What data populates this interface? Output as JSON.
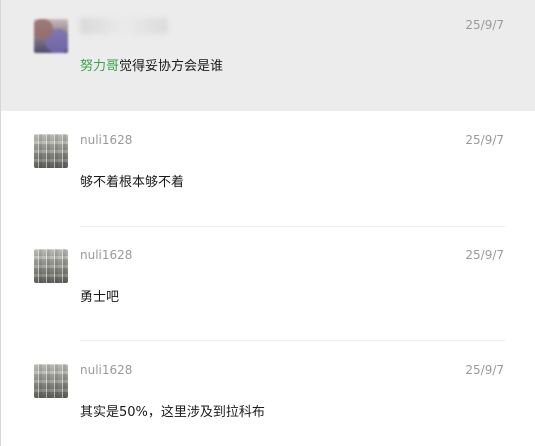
{
  "comments": [
    {
      "username": "",
      "time": "25/9/7",
      "mention": "努力哥",
      "text": "觉得妥协方会是谁",
      "highlighted": true,
      "avatar": "blurred-user-avatar"
    },
    {
      "username": "nuli1628",
      "time": "25/9/7",
      "text": "够不着根本够不着",
      "highlighted": false,
      "avatar": "landscape-avatar"
    },
    {
      "username": "nuli1628",
      "time": "25/9/7",
      "text": "勇士吧",
      "highlighted": false,
      "avatar": "landscape-avatar"
    },
    {
      "username": "nuli1628",
      "time": "25/9/7",
      "text": "其实是50%，这里涉及到拉科布",
      "highlighted": false,
      "avatar": "landscape-avatar"
    }
  ],
  "colors": {
    "highlight_background": "#ececec",
    "mention": "#39a24b",
    "meta_text": "#9a9a9a",
    "body_text": "#1a1a1a",
    "divider": "#ececec"
  }
}
